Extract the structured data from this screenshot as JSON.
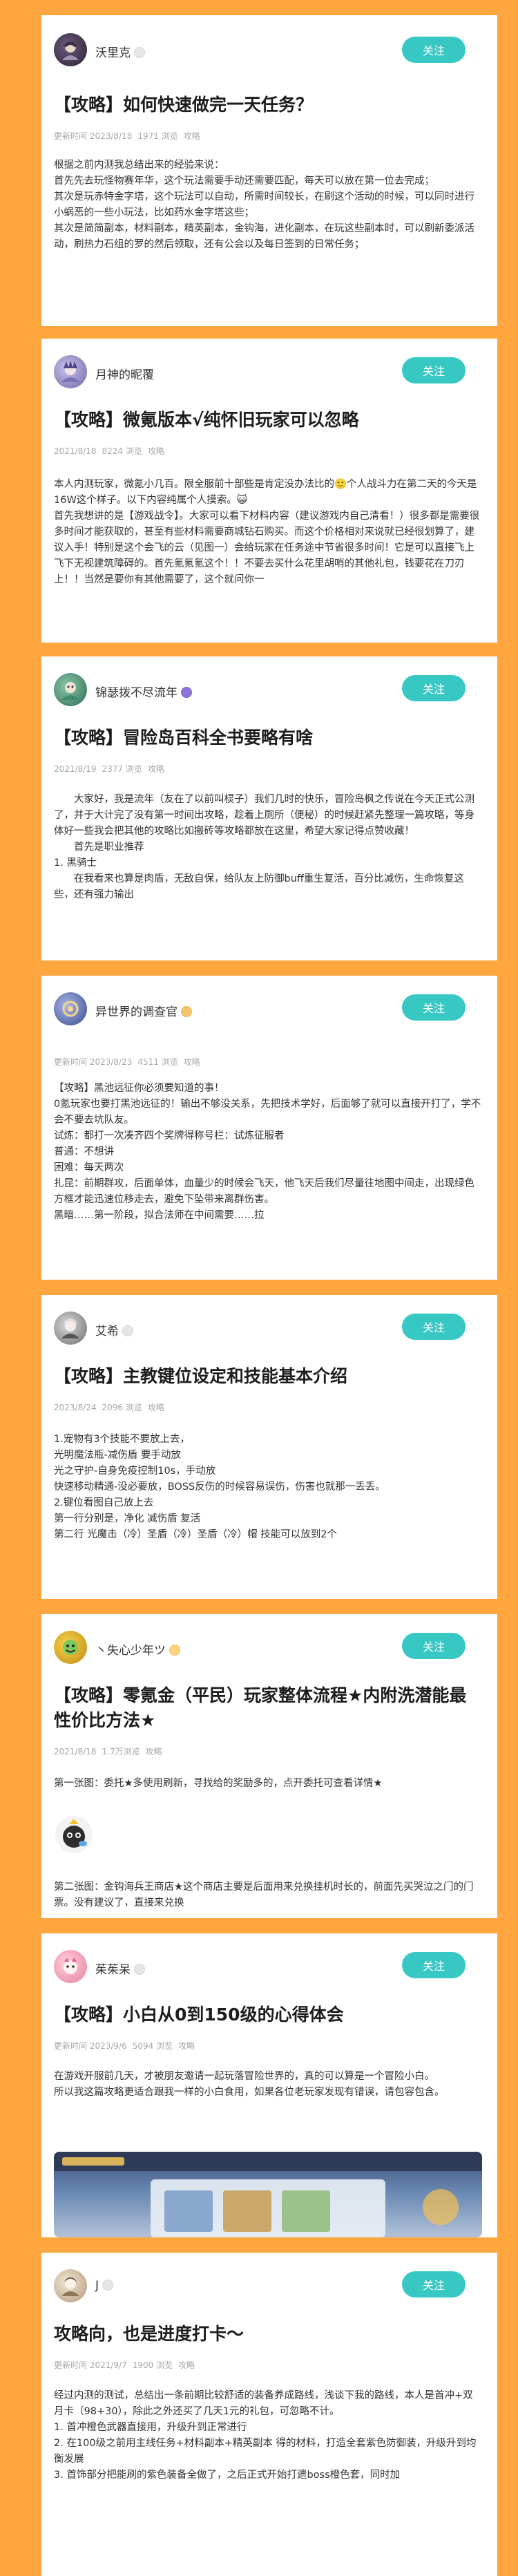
{
  "follow_label": "关注",
  "colors": {
    "background": "#ffa63f",
    "follow": "#37c8c4",
    "meta": "#a7a7a7"
  },
  "posts": [
    {
      "author": "沃里克",
      "title": "【攻略】如何快速做完一天任务？",
      "meta": {
        "update_prefix": "更新时间 2023/8/18",
        "views": "1971 浏览",
        "tag": "攻略"
      },
      "body": [
        "根据之前内测我总结出来的经验来说：",
        "首先先去玩怪物赛年华，这个玩法需要手动还需要匹配，每天可以放在第一位去完成；",
        "其次是玩赤特金字塔，这个玩法可以自动，所需时间较长，在刷这个活动的时候，可以同时进行小蜗恶的一些小玩法，比如药水金字塔这些；",
        "其次是简简副本，材料副本，精英副本，金钩海，进化副本，在玩这些副本时，可以刷新委派活动，刷热力石组的罗的然后领取，还有公会以及每日签到的日常任务；"
      ]
    },
    {
      "author": "月神的昵覆",
      "title": "【攻略】微氪版本√纯怀旧玩家可以忽略",
      "meta": {
        "update_prefix": "2021/8/18",
        "views": "8224 浏览",
        "tag": "攻略"
      },
      "body": [
        "本人内测玩家，微氪小几百。限全服前十部些是肯定没办法比的🙂个人战斗力在第二天的今天是16W这个样子。以下内容纯属个人摸索。😺",
        "首先我想讲的是【游戏战令】。大家可以看下材料内容（建议游戏内自己清看！）很多都是需要很多时间才能获取的，甚至有些材料需要商城钻石购买。而这个价格相对来说就已经很划算了，建议入手！特别是这个会飞的云（见图一）会给玩家在任务途中节省很多时间！它是可以直接飞上飞下无视建筑障碍的。首先氪氪氪这个！！不要去买什么花里胡哨的其他礼包，钱要花在刀刃上！！当然是要你有其他需要了，这个就问你一"
      ]
    },
    {
      "author": "锦瑟拨不尽流年",
      "title": "【攻略】冒险岛百科全书要略有啥",
      "meta": {
        "update_prefix": "2021/8/19",
        "views": "2377 浏览",
        "tag": "攻略"
      },
      "body": [
        "大家好，我是流年（友在了以前叫棂子）我们几时的快乐，冒险岛枫之传说在今天正式公测了，并于大计完了没有第一时间出攻略，趁着上厕所（便秘）的时候赶紧先整理一篇攻略，等身体好一些我会把其他的攻略比如搬砖等攻略都放在这里，希望大家记得点赞收藏！",
        "首先是职业推荐",
        "1. 黑骑士",
        "在我看来也算是肉盾，无敌自保，给队友上防御buff重生复活，百分比减伤，生命恢复这些，还有强力输出"
      ]
    },
    {
      "author": "异世界的调查官",
      "title": "",
      "meta": {
        "update_prefix": "更新时间 2023/8/23",
        "views": "4511 浏览",
        "tag": "攻略"
      },
      "body": [
        "【攻略】黑池远征你必须要知道的事！",
        "0氪玩家也要打黑池远征的！输出不够没关系，先把技术学好，后面够了就可以直接开打了，学不会不要去坑队友。",
        "试炼：都打一次凑齐四个奖牌得称号栏：试炼征服者",
        "普通：不想讲",
        "困难：每天两次",
        "扎昆：前期群攻，后面单体，血量少的时候会飞天，他飞天后我们尽量往地图中间走，出现绿色方框才能迅速位移走去，避免下坠带来离群伤害。",
        "黑暗……第一阶段，拟合法师在中间需要……拉"
      ]
    },
    {
      "author": "艾希",
      "title": "【攻略】主教键位设定和技能基本介绍",
      "meta": {
        "update_prefix": "2023/8/24",
        "views": "2096 浏览",
        "tag": "攻略"
      },
      "body": [
        "1.宠物有3个技能不要放上去，",
        "光明魔法瓶-减伤盾 要手动放",
        "光之守护-自身免疫控制10s，手动放",
        "快速移动精通-没必要放，BOSS反伤的时候容易误伤，伤害也就那一丢丢。",
        "2.键位看图自己放上去",
        "第一行分别是，净化 减伤盾 复活",
        "第二行 光魔击（冷）圣盾（冷）圣盾（冷）帽 技能可以放到2个"
      ]
    },
    {
      "author": "丶失心少年ツ",
      "title": "【攻略】零氪金（平民）玩家整体流程★内附洗潜能最性价比方法★",
      "meta": {
        "update_prefix": "2021/8/18",
        "views": "1.7万浏览",
        "tag": "攻略"
      },
      "body": [
        "第一张图：委托★多使用刷新，寻找给的奖励多的，点开委托可查看详情★",
        "第二张图：金钩海兵王商店★这个商店主要是后面用来兑换挂机时长的，前面先买哭泣之门的门票。没有建议了，直接来兑换"
      ]
    },
    {
      "author": "茱茱呆",
      "title": "【攻略】小白从0到150级的心得体会",
      "meta": {
        "update_prefix": "更新时间 2023/9/6",
        "views": "5094 浏览",
        "tag": "攻略"
      },
      "body": [
        "在游戏开服前几天，才被朋友邀请一起玩落冒险世界的，真的可以算是一个冒险小白。",
        "所以我这篇攻略更适合跟我一样的小白食用，如果各位老玩家发现有错误，请包容包含。"
      ]
    },
    {
      "author": "J",
      "title": "攻略向，也是进度打卡～",
      "meta": {
        "update_prefix": "更新时间 2021/9/7",
        "views": "1900 浏览",
        "tag": "攻略"
      },
      "body": [
        "经过内测的测试，总结出一条前期比较舒适的装备养成路线，浅谈下我的路线，本人是首冲+双月卡（98+30），除此之外还买了几天1元的礼包，可忽略不计。",
        "1. 首冲橙色武器直接用，升级升到正常进行",
        "2. 在100级之前用主线任务+材料副本+精英副本 得的材料，打造全套紫色防御装，升级升到均衡发展",
        "3. 首饰部分把能刷的紫色装备全做了，之后正式开始打遗boss橙色套，同时加"
      ]
    }
  ]
}
